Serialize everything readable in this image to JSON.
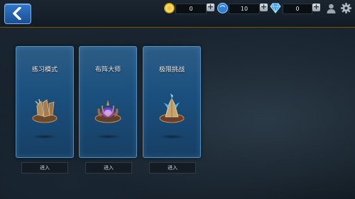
{
  "header": {
    "back_icon": "back-arrow-icon",
    "gold": {
      "icon": "gold-coin-icon",
      "value": "0",
      "color": "#f5c431"
    },
    "crystal": {
      "icon": "blue-orb-icon",
      "value": "10",
      "color": "#3c8ee8"
    },
    "diamond": {
      "icon": "diamond-icon",
      "value": "0",
      "color": "#3aa3f0"
    },
    "plus_label": "+",
    "profile_icon": "user-icon",
    "settings_icon": "gear-icon"
  },
  "modes": [
    {
      "title": "练习模式",
      "art": "broken-shield-icon",
      "enter_label": "进入"
    },
    {
      "title": "布阵大师",
      "art": "crystal-altar-icon",
      "enter_label": "进入"
    },
    {
      "title": "极限挑战",
      "art": "ice-crystal-icon",
      "enter_label": "进入"
    }
  ]
}
